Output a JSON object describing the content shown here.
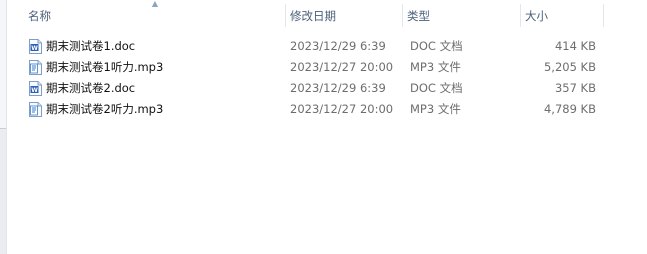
{
  "columns": {
    "name": "名称",
    "date": "修改日期",
    "type": "类型",
    "size": "大小"
  },
  "files": [
    {
      "name": "期末测试卷1.doc",
      "date": "2023/12/29 6:39",
      "type": "DOC 文档",
      "size": "414 KB",
      "icon": "word-doc-icon"
    },
    {
      "name": "期末测试卷1听力.mp3",
      "date": "2023/12/27 20:00",
      "type": "MP3 文件",
      "size": "5,205 KB",
      "icon": "mp3-file-icon"
    },
    {
      "name": "期末测试卷2.doc",
      "date": "2023/12/29 6:39",
      "type": "DOC 文档",
      "size": "357 KB",
      "icon": "word-doc-icon"
    },
    {
      "name": "期末测试卷2听力.mp3",
      "date": "2023/12/27 20:00",
      "type": "MP3 文件",
      "size": "4,789 KB",
      "icon": "mp3-file-icon"
    }
  ],
  "colors": {
    "header_text": "#4c607a",
    "doc_icon": "#2b5fb4",
    "mp3_icon": "#3a7bc8"
  }
}
